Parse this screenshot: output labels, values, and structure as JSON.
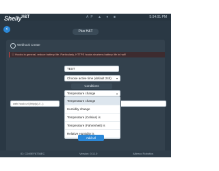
{
  "status": {
    "logo": "Shelly",
    "logo_suffix": "H&T",
    "icons": "AP  ▲  ●  ■",
    "clock": "5:54:01 PM"
  },
  "header": {
    "back_icon": "chevron-left-icon",
    "title": "Plus H&T"
  },
  "webhook": {
    "heading": "Webhook Create",
    "warning": "Hooks in general, reduce battery life. Particularly, HTTPS hooks shortens battery life in half!",
    "name_value": "TEST",
    "active_times_value": "Choose active time (default 24h)",
    "conditions_label": "Conditions",
    "condition_selected": "Temperature change",
    "condition_options": [
      "Temperature change",
      "Humidity change",
      "Temperature (Celsius) is",
      "Temperature (Fahrenheit) is",
      "Relative Humidity is"
    ],
    "url_value": "web hook url (http(s)://...)",
    "add_button": "Add url"
  },
  "footer": {
    "device_id": "ID: C049EF8736EC",
    "version": "Version: 0.11.0",
    "brand": "Allterco Robotics"
  },
  "colors": {
    "background": "#2a3844",
    "accent": "#2b88d8",
    "warning_text": "#e6b3a6"
  }
}
